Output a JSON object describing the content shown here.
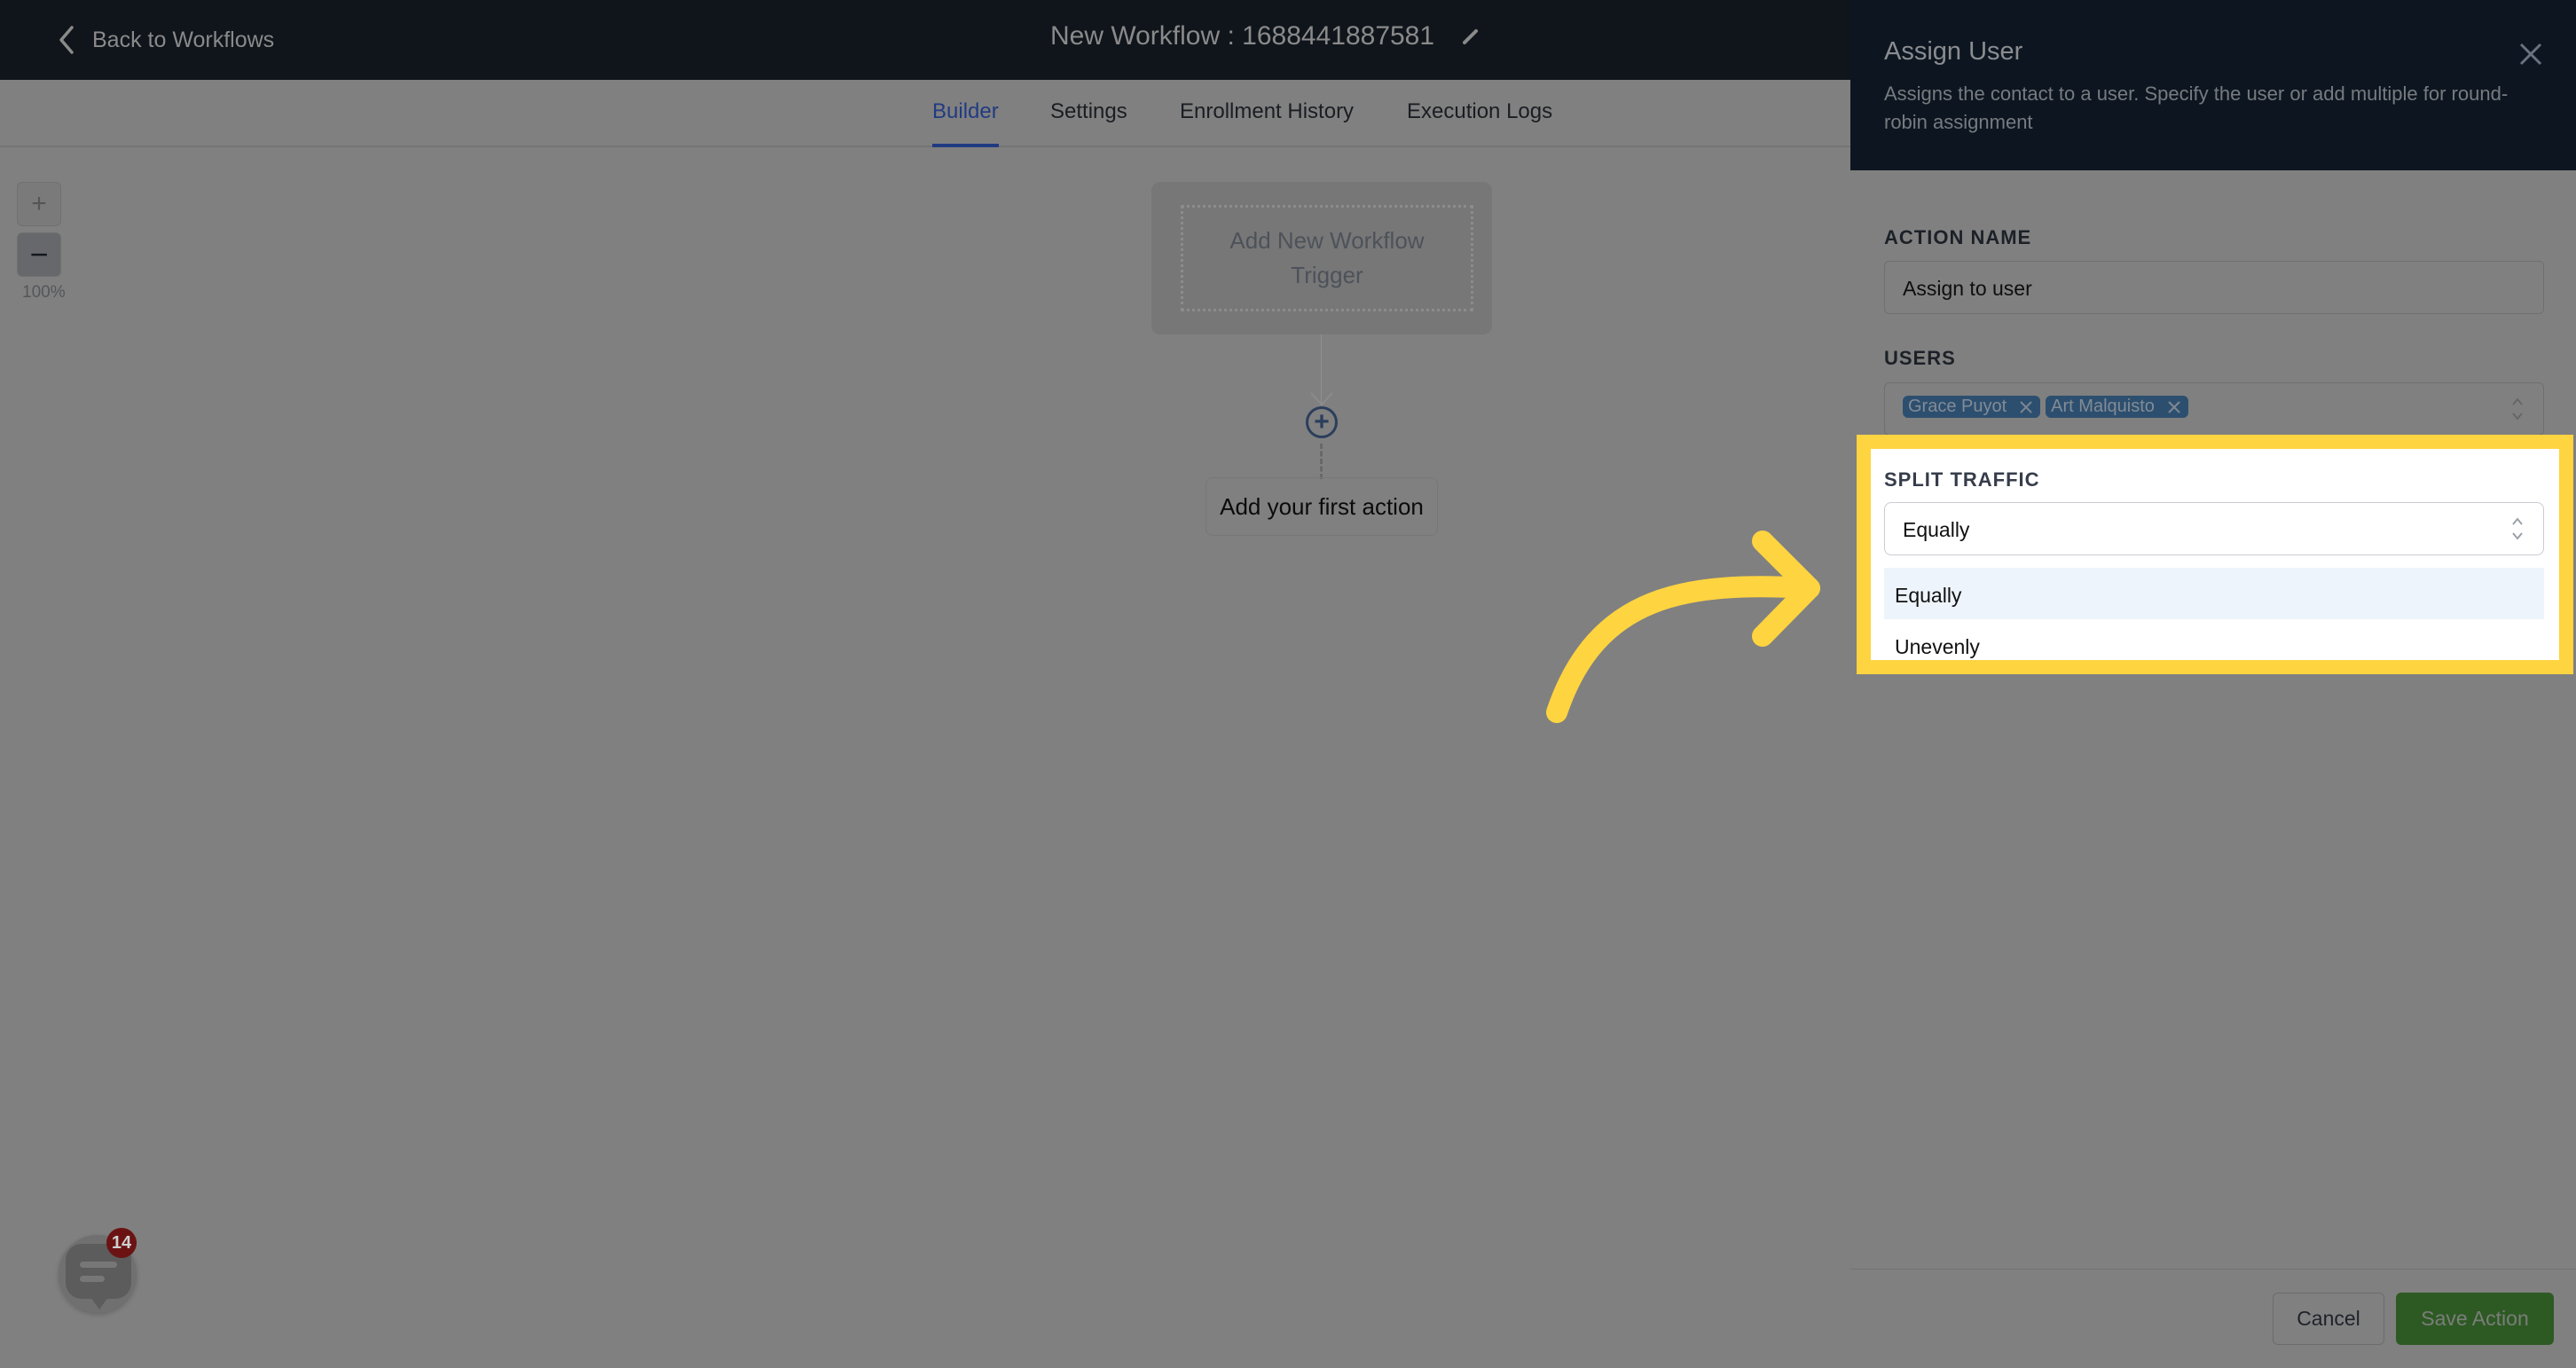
{
  "header": {
    "back_label": "Back to Workflows",
    "workflow_title": "New Workflow : 1688441887581"
  },
  "tabs": [
    {
      "label": "Builder",
      "active": true
    },
    {
      "label": "Settings",
      "active": false
    },
    {
      "label": "Enrollment History",
      "active": false
    },
    {
      "label": "Execution Logs",
      "active": false
    }
  ],
  "canvas": {
    "zoom_in_label": "+",
    "zoom_out_label": "−",
    "zoom_level": "100%",
    "trigger_label": "Add New Workflow Trigger",
    "add_icon": "+",
    "first_action_label": "Add your first action"
  },
  "chat_widget": {
    "badge_count": "14"
  },
  "panel": {
    "title": "Assign User",
    "description": "Assigns the contact to a user. Specify the user or add multiple for round-robin assignment",
    "action_name_label": "ACTION NAME",
    "action_name_value": "Assign to user",
    "users_label": "USERS",
    "users": [
      "Grace Puyot",
      "Art Malquisto"
    ],
    "split_traffic_label": "SPLIT TRAFFIC",
    "split_traffic_value": "Equally",
    "split_traffic_options": [
      "Equally",
      "Unevenly"
    ],
    "cancel_label": "Cancel",
    "save_label": "Save Action"
  },
  "colors": {
    "highlight": "#fed440",
    "active_tab": "#213b82",
    "save_button": "#2d5a23",
    "chip": "#2d4f6f",
    "badge": "#6b1313"
  }
}
